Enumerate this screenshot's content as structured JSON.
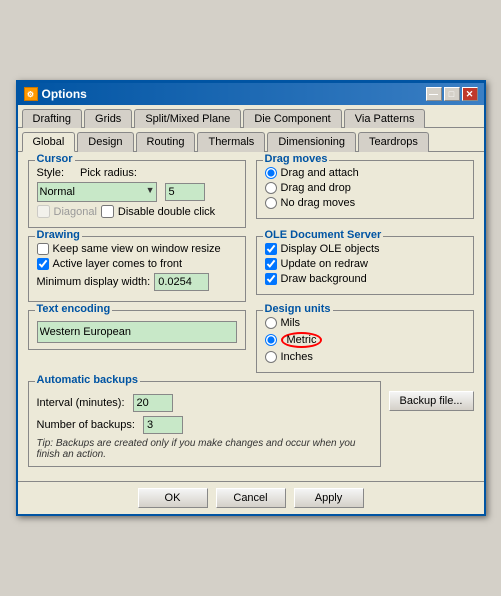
{
  "window": {
    "title": "Options",
    "icon": "⚙"
  },
  "tabs_row1": {
    "items": [
      {
        "label": "Drafting",
        "active": false
      },
      {
        "label": "Grids",
        "active": false
      },
      {
        "label": "Split/Mixed Plane",
        "active": false
      },
      {
        "label": "Die Component",
        "active": false
      },
      {
        "label": "Via Patterns",
        "active": false
      }
    ]
  },
  "tabs_row2": {
    "items": [
      {
        "label": "Global",
        "active": true
      },
      {
        "label": "Design",
        "active": false
      },
      {
        "label": "Routing",
        "active": false
      },
      {
        "label": "Thermals",
        "active": false
      },
      {
        "label": "Dimensioning",
        "active": false
      },
      {
        "label": "Teardrops",
        "active": false
      }
    ]
  },
  "cursor_section": {
    "label": "Cursor",
    "style_label": "Style:",
    "style_value": "Normal",
    "pick_radius_label": "Pick radius:",
    "pick_radius_value": "5",
    "diagonal_label": "Diagonal",
    "disable_dbl_click_label": "Disable double click"
  },
  "drag_moves_section": {
    "label": "Drag moves",
    "options": [
      {
        "label": "Drag and attach",
        "checked": true
      },
      {
        "label": "Drag and drop",
        "checked": false
      },
      {
        "label": "No drag moves",
        "checked": false
      }
    ]
  },
  "drawing_section": {
    "label": "Drawing",
    "options": [
      {
        "label": "Keep same view on window resize",
        "checked": false
      },
      {
        "label": "Active layer comes to front",
        "checked": true
      }
    ],
    "min_display_label": "Minimum display width:",
    "min_display_value": "0.0254"
  },
  "ole_section": {
    "label": "OLE Document Server",
    "options": [
      {
        "label": "Display OLE objects",
        "checked": true
      },
      {
        "label": "Update on redraw",
        "checked": true
      },
      {
        "label": "Draw background",
        "checked": true
      }
    ]
  },
  "text_encoding_section": {
    "label": "Text encoding",
    "value": "Western European"
  },
  "design_units_section": {
    "label": "Design units",
    "options": [
      {
        "label": "Mils",
        "checked": false
      },
      {
        "label": "Metric",
        "checked": true,
        "highlight": true
      },
      {
        "label": "Inches",
        "checked": false
      }
    ]
  },
  "auto_backups_section": {
    "label": "Automatic backups",
    "interval_label": "Interval (minutes):",
    "interval_value": "20",
    "num_backups_label": "Number of backups:",
    "num_backups_value": "3",
    "tip": "Tip: Backups are created only if you make changes and occur when you finish an action.",
    "backup_btn_label": "Backup file..."
  },
  "footer": {
    "ok_label": "OK",
    "cancel_label": "Cancel",
    "apply_label": "Apply"
  },
  "title_buttons": {
    "minimize": "—",
    "maximize": "□",
    "close": "✕"
  }
}
